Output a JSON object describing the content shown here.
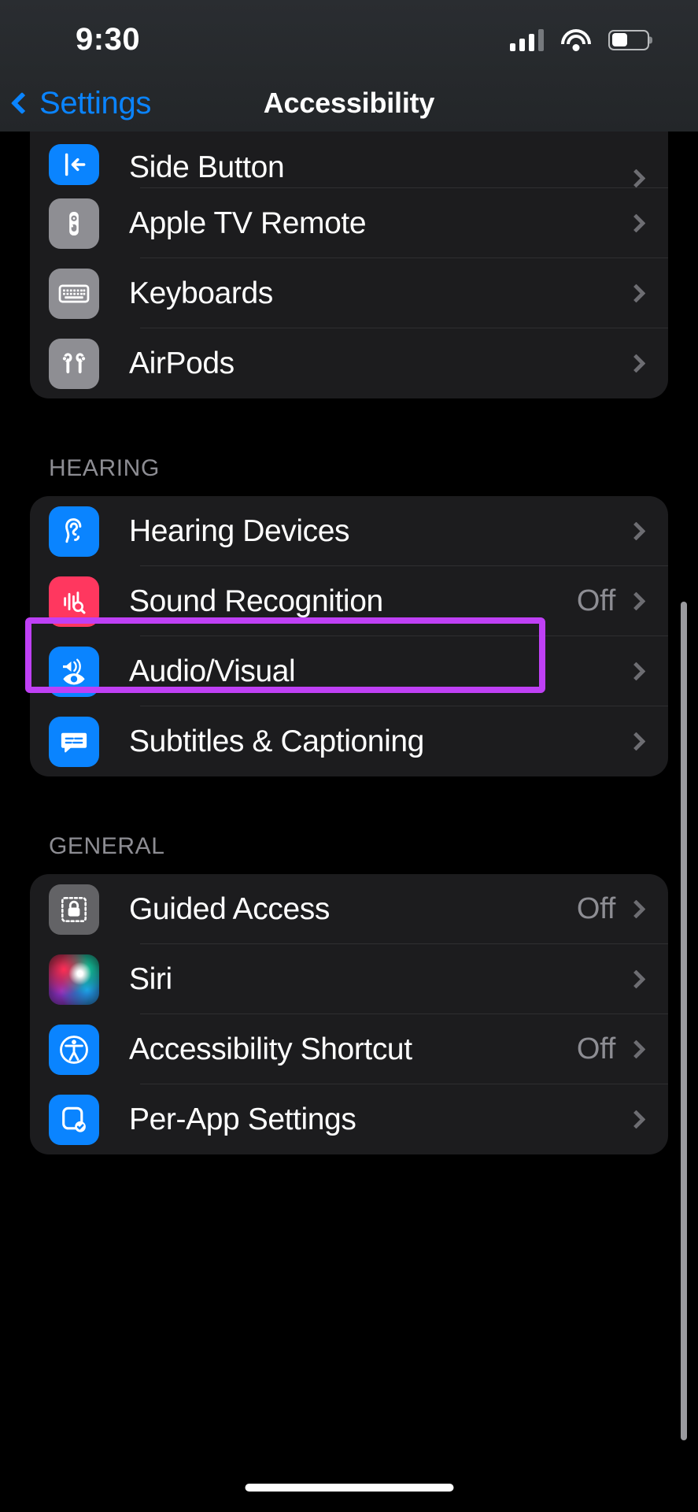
{
  "status_bar": {
    "time": "9:30",
    "cellular_icon": "cellular-bars-icon",
    "cellular_bars_filled": 3,
    "cellular_bars_total": 4,
    "wifi_icon": "wifi-icon",
    "battery_icon": "battery-icon",
    "battery_level_percent": 45
  },
  "nav": {
    "back_label": "Settings",
    "back_icon": "chevron-left-icon",
    "title": "Accessibility"
  },
  "highlight": {
    "color": "#bf40f5",
    "target": "Audio/Visual"
  },
  "sections": [
    {
      "header": "",
      "items": [
        {
          "label": "Side Button",
          "icon": "side-button-icon",
          "icon_color": "blue",
          "value": "",
          "chevron": true
        },
        {
          "label": "Apple TV Remote",
          "icon": "apple-tv-remote-icon",
          "icon_color": "gray",
          "value": "",
          "chevron": true
        },
        {
          "label": "Keyboards",
          "icon": "keyboard-icon",
          "icon_color": "gray",
          "value": "",
          "chevron": true
        },
        {
          "label": "AirPods",
          "icon": "airpods-icon",
          "icon_color": "gray",
          "value": "",
          "chevron": true
        }
      ]
    },
    {
      "header": "HEARING",
      "items": [
        {
          "label": "Hearing Devices",
          "icon": "ear-icon",
          "icon_color": "blue",
          "value": "",
          "chevron": true
        },
        {
          "label": "Sound Recognition",
          "icon": "waveform-search-icon",
          "icon_color": "red",
          "value": "Off",
          "chevron": true
        },
        {
          "label": "Audio/Visual",
          "icon": "speaker-eye-icon",
          "icon_color": "blue",
          "value": "",
          "chevron": true
        },
        {
          "label": "Subtitles & Captioning",
          "icon": "captions-icon",
          "icon_color": "blue",
          "value": "",
          "chevron": true
        }
      ]
    },
    {
      "header": "GENERAL",
      "items": [
        {
          "label": "Guided Access",
          "icon": "lock-dashed-icon",
          "icon_color": "darkgray",
          "value": "Off",
          "chevron": true
        },
        {
          "label": "Siri",
          "icon": "siri-orb-icon",
          "icon_color": "siri",
          "value": "",
          "chevron": true
        },
        {
          "label": "Accessibility Shortcut",
          "icon": "accessibility-icon",
          "icon_color": "blue",
          "value": "Off",
          "chevron": true
        },
        {
          "label": "Per-App Settings",
          "icon": "app-check-icon",
          "icon_color": "blue",
          "value": "",
          "chevron": true
        }
      ]
    }
  ]
}
